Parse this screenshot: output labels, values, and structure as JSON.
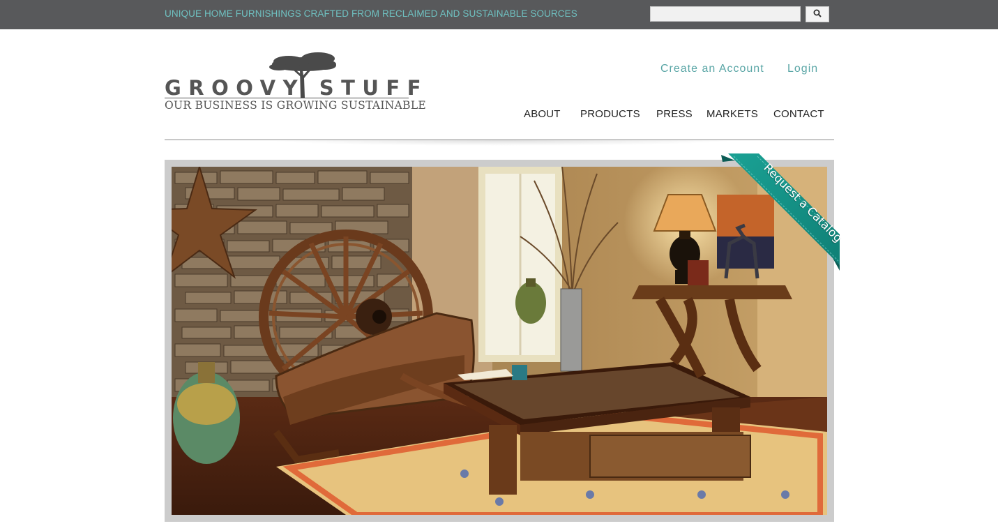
{
  "topbar": {
    "tagline": "UNIQUE HOME FURNISHINGS CRAFTED FROM RECLAIMED AND SUSTAINABLE SOURCES",
    "search_value": "",
    "search_icon": "search-icon"
  },
  "logo": {
    "wordmark": "GROOVY STUFF",
    "subtitle": "OUR BUSINESS IS GROWING SUSTAINABLE"
  },
  "account": {
    "create_label": "Create an Account",
    "login_label": "Login"
  },
  "nav": {
    "items": [
      "ABOUT",
      "PRODUCTS",
      "PRESS",
      "MARKETS",
      "CONTACT"
    ]
  },
  "hero": {
    "ribbon_label": "Request a Catalog"
  },
  "colors": {
    "topbar": "#58595b",
    "accent_teal": "#5aa6a6",
    "ribbon": "#139187"
  }
}
